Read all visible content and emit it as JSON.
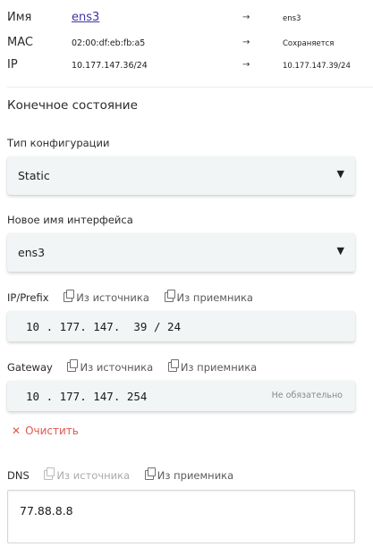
{
  "summary": {
    "rows": [
      {
        "key": "Имя",
        "current": "ens3",
        "arrow": "→",
        "next": "ens3"
      },
      {
        "key": "MAC",
        "current": "02:00:df:eb:fb:a5",
        "arrow": "→",
        "next": "Сохраняется"
      },
      {
        "key": "IP",
        "current": "10.177.147.36/24",
        "arrow": "→",
        "next": "10.177.147.39/24"
      }
    ]
  },
  "final_state": {
    "title": "Конечное состояние",
    "config_type": {
      "label": "Тип конфигурации",
      "value": "Static",
      "caret": "▼"
    },
    "new_name": {
      "label": "Новое имя интерфейса",
      "value": "ens3",
      "caret": "▼"
    },
    "ip_prefix": {
      "label": "IP/Prefix",
      "from_source": "Из источника",
      "from_target": "Из приемника",
      "value": "10 . 177. 147.  39 / 24"
    },
    "gateway": {
      "label": "Gateway",
      "from_source": "Из источника",
      "from_target": "Из приемника",
      "value": "10 . 177. 147. 254",
      "hint": "Не обязательно"
    },
    "clear": {
      "icon": "✕",
      "label": "Очистить"
    },
    "dns": {
      "label": "DNS",
      "from_source": "Из источника",
      "from_target": "Из приемника",
      "value": "77.88.8.8"
    }
  }
}
